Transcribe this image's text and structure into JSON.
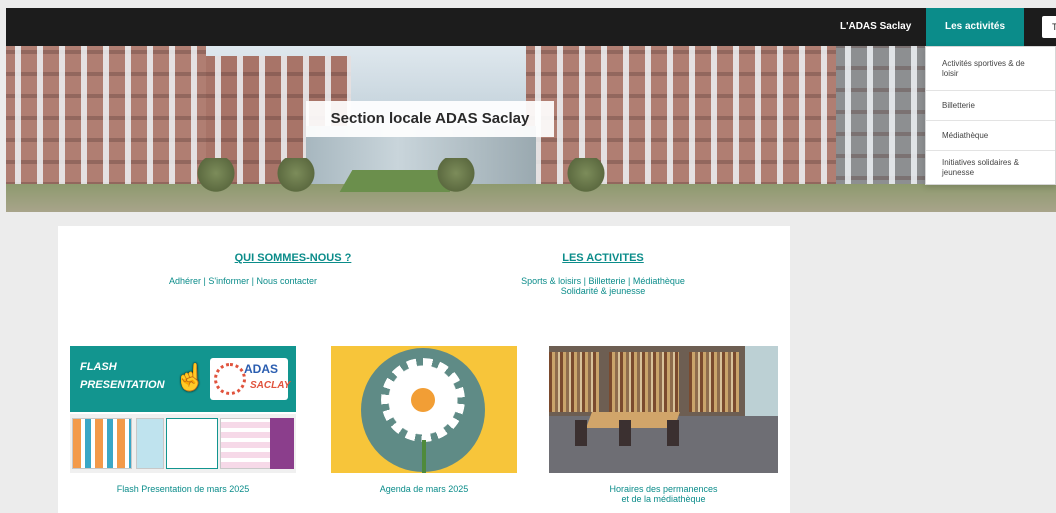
{
  "nav": {
    "site_name": "L'ADAS Saclay",
    "active_item": "Les activités",
    "extra_partial": "T"
  },
  "hero": {
    "title": "Section locale ADAS Saclay"
  },
  "dropdown": {
    "items": [
      "Activités sportives & de loisir",
      "Billetterie",
      "Médiathèque",
      "Initiatives solidaires & jeunesse"
    ]
  },
  "main": {
    "who": {
      "heading": "QUI SOMMES-NOUS ?",
      "links": "Adhérer | S'informer | Nous contacter"
    },
    "activities": {
      "heading": "LES ACTIVITES",
      "links_line1": "Sports & loisirs | Billetterie | Médiathèque",
      "links_line2": "Solidarité & jeunesse"
    },
    "cards": [
      {
        "caption": "Flash Presentation de mars 2025",
        "flash_line1": "FLASH",
        "flash_line2": "PRESENTATION",
        "logo_top": "ADAS",
        "logo_bottom": "SACLAY"
      },
      {
        "caption": "Agenda de mars 2025"
      },
      {
        "caption_line1": "Horaires des permanences",
        "caption_line2": "et de la médiathèque"
      }
    ]
  },
  "colors": {
    "accent": "#0b8c8a",
    "topbar": "#1c1c1c",
    "agenda_bg": "#f7c53a"
  }
}
